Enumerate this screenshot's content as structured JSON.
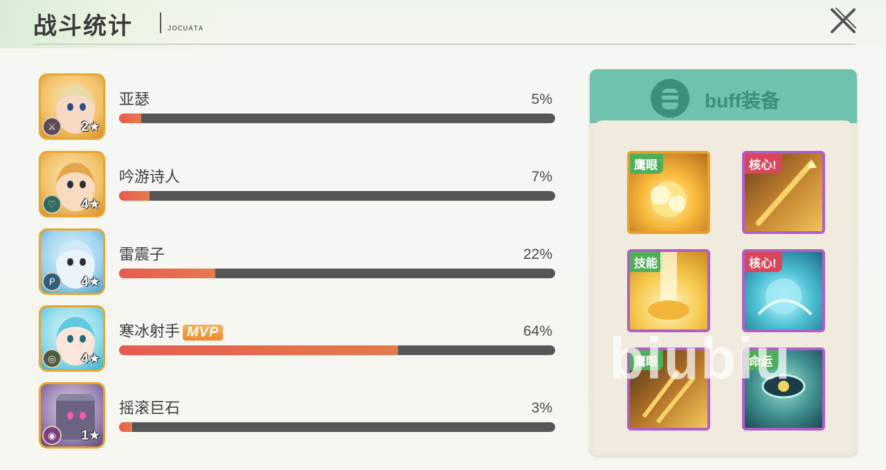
{
  "header": {
    "title": "战斗统计",
    "subtitle": "ᴊᴏᴄᴜᴀᴛᴀ"
  },
  "players": [
    {
      "name": "亚瑟",
      "percent_label": "5%",
      "percent": 5,
      "level": "2",
      "role_icon": "swords-icon",
      "mvp": false
    },
    {
      "name": "吟游诗人",
      "percent_label": "7%",
      "percent": 7,
      "level": "4",
      "role_icon": "heart-icon",
      "mvp": false
    },
    {
      "name": "雷震子",
      "percent_label": "22%",
      "percent": 22,
      "level": "4",
      "role_icon": "staff-icon",
      "mvp": false
    },
    {
      "name": "寒冰射手",
      "percent_label": "64%",
      "percent": 64,
      "level": "4",
      "role_icon": "target-icon",
      "mvp": true,
      "mvp_label": "MVP"
    },
    {
      "name": "摇滚巨石",
      "percent_label": "3%",
      "percent": 3,
      "level": "1",
      "role_icon": "shield-icon",
      "mvp": false
    }
  ],
  "buff_panel": {
    "title": "buff装备",
    "items": [
      {
        "tag": "鹰眼",
        "tag_color": "green",
        "frame": "gold",
        "art": "explosion-icon"
      },
      {
        "tag": "核心!",
        "tag_color": "red",
        "frame": "purple",
        "art": "spear-icon"
      },
      {
        "tag": "技能",
        "tag_color": "green",
        "frame": "purple",
        "art": "light-beam-icon"
      },
      {
        "tag": "核心!",
        "tag_color": "red",
        "frame": "purple",
        "art": "water-orb-icon"
      },
      {
        "tag": "鹰眼",
        "tag_color": "green",
        "frame": "purple",
        "art": "arrows-icon"
      },
      {
        "tag": "命运",
        "tag_color": "green",
        "frame": "purple",
        "art": "eye-icon"
      }
    ]
  },
  "watermark": "biubiu",
  "colors": {
    "bar_fill": "#e85b4f",
    "bar_track": "#565656",
    "panel_accent": "#6fc2ae"
  }
}
